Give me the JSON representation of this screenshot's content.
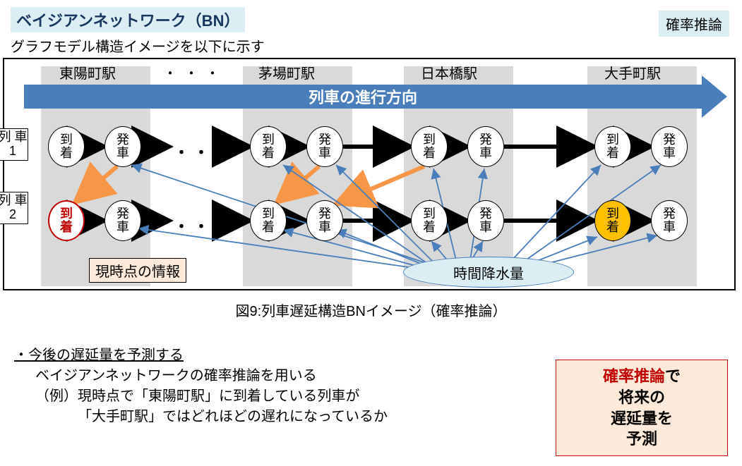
{
  "title": "ベイジアンネットワーク（BN）",
  "top_right": "確率推論",
  "subtitle": "グラフモデル構造イメージを以下に示す",
  "direction_label": "列車の進行方向",
  "stations": {
    "s1": "東陽町駅",
    "ellipsis": "・・・",
    "s2": "茅場町駅",
    "s3": "日本橋駅",
    "s4": "大手町駅"
  },
  "trains": {
    "t1": "列\n車\n1",
    "t2": "列\n車\n2"
  },
  "node_arr": "到\n着",
  "node_dep": "発\n車",
  "row_ellipsis": "・・・",
  "info_now": "現時点の情報",
  "rain": "時間降水量",
  "caption": "図9:列車遅延構造BNイメージ（確率推論）",
  "bullet": {
    "heading": "・今後の遅延量を予測する",
    "l1": "ベイジアンネットワークの確率推論を用いる",
    "l2": "（例）現時点で「東陽町駅」に到着している列車が",
    "l3": "「大手町駅」ではどれほどの遅れになっているか"
  },
  "future_box": {
    "p1a": "確率推論",
    "p1b": "で",
    "p2": "将来の",
    "p3": "遅延量を",
    "p4": "予測"
  }
}
